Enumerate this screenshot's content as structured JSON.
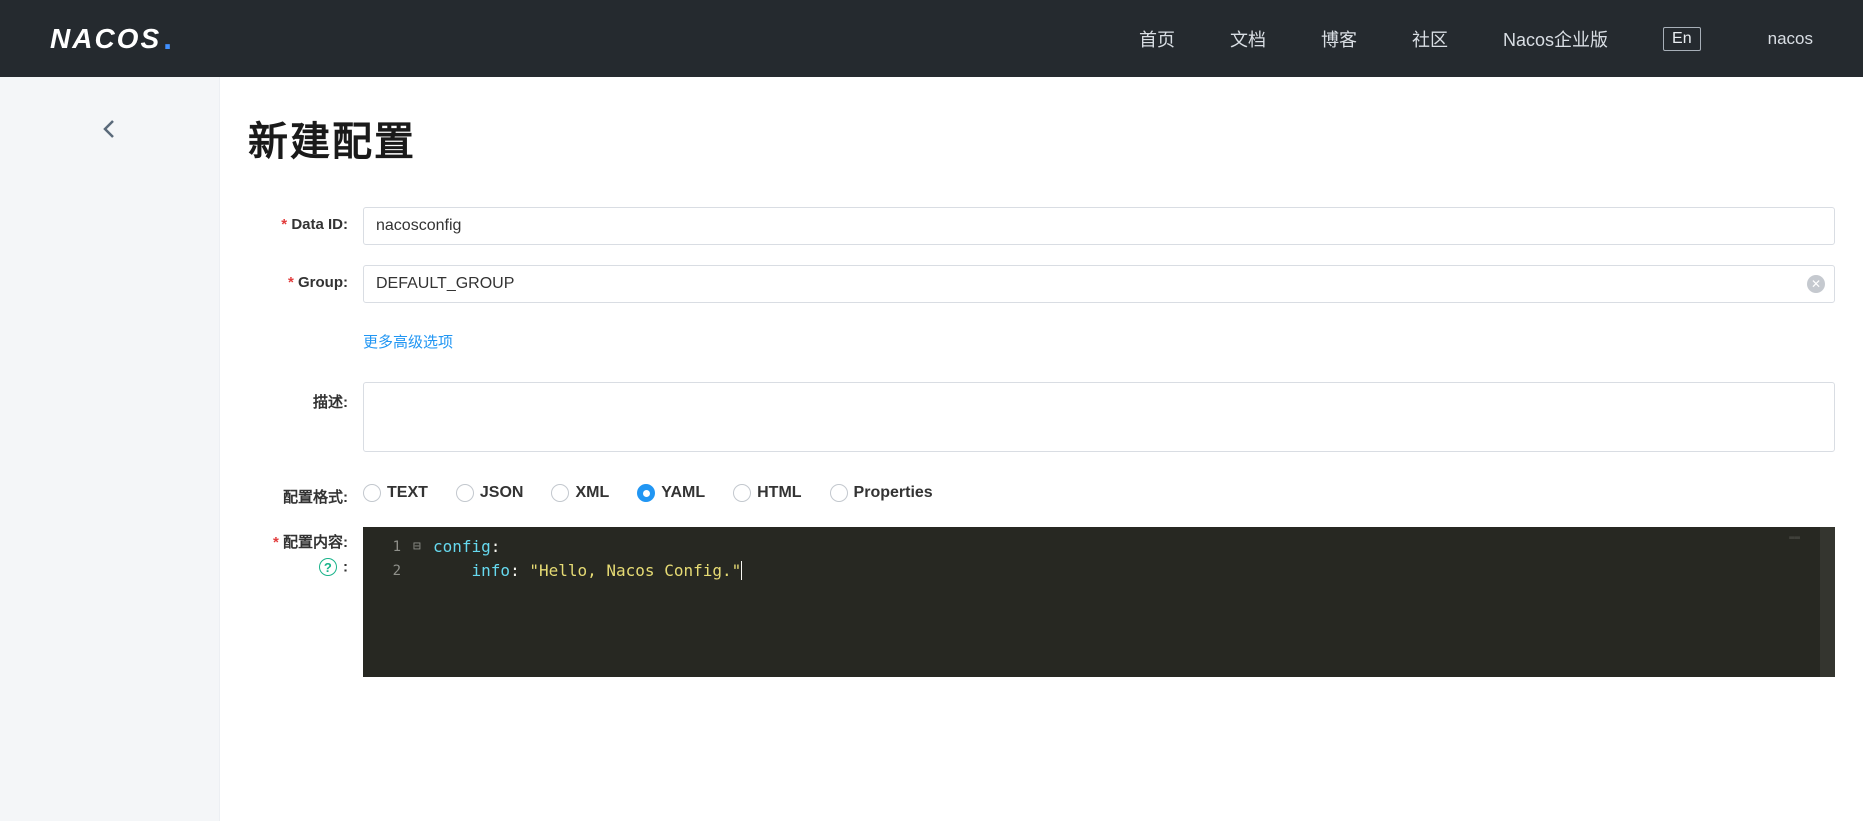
{
  "header": {
    "logo_text": "NACOS",
    "nav": {
      "home": "首页",
      "docs": "文档",
      "blog": "博客",
      "community": "社区",
      "enterprise": "Nacos企业版"
    },
    "lang_btn": "En",
    "user": "nacos"
  },
  "page": {
    "title": "新建配置"
  },
  "form": {
    "data_id": {
      "label": "Data ID:",
      "value": "nacosconfig"
    },
    "group": {
      "label": "Group:",
      "value": "DEFAULT_GROUP"
    },
    "advanced_link": "更多高级选项",
    "description": {
      "label": "描述:",
      "value": ""
    },
    "format": {
      "label": "配置格式:",
      "options": [
        "TEXT",
        "JSON",
        "XML",
        "YAML",
        "HTML",
        "Properties"
      ],
      "selected": "YAML"
    },
    "content": {
      "label": "配置内容:",
      "help_symbol": "?",
      "code_lines": [
        {
          "num": "1",
          "fold": "⊟",
          "key": "config",
          "colon": ":"
        },
        {
          "num": "2",
          "fold": "",
          "indent": "    ",
          "key": "info",
          "colon": ": ",
          "string": "\"Hello, Nacos Config.\""
        }
      ]
    }
  }
}
